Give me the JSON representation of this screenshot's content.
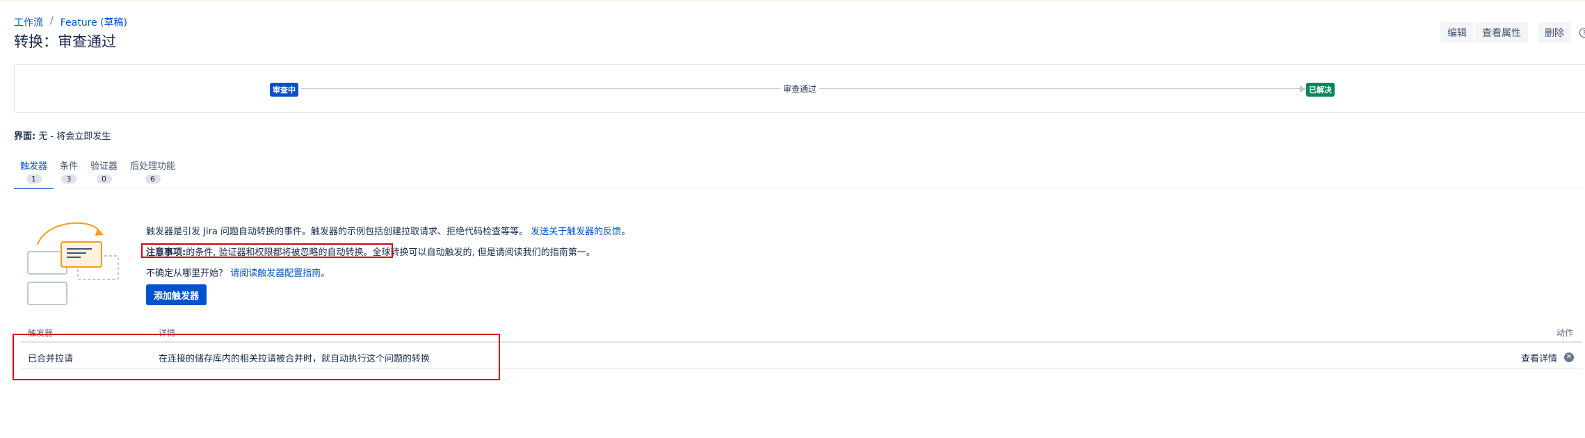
{
  "breadcrumb": {
    "root": "工作流",
    "separator": "/",
    "current": "Feature (草稿)"
  },
  "page_title": "转换：审查通过",
  "header_actions": {
    "edit": "编辑",
    "properties": "查看属性",
    "delete": "删除",
    "help": "?"
  },
  "workflow": {
    "from_status": "审查中",
    "transition": "审查通过",
    "to_status": "已解决",
    "colors": {
      "from": "#0052cc",
      "to": "#00875a"
    }
  },
  "screen": {
    "label": "界面:",
    "value": "无 - 将会立即发生"
  },
  "tabs": [
    {
      "label": "触发器",
      "count": "1",
      "active": true
    },
    {
      "label": "条件",
      "count": "3",
      "active": false
    },
    {
      "label": "验证器",
      "count": "0",
      "active": false
    },
    {
      "label": "后处理功能",
      "count": "6",
      "active": false
    }
  ],
  "info": {
    "line1_text": "触发器是引发 Jira 问题自动转换的事件。触发器的示例包括创建拉取请求、拒绝代码检查等等。",
    "line1_link": "发送关于触发器的反馈",
    "line1_end": "。",
    "line2_bold": "注意事项:",
    "line2_text": "的条件, 验证器和权限都将被忽略的自动转换。全球转换可以自动触发的, 但是请阅读我们的指南第一。",
    "line3_text": "不确定从哪里开始？",
    "line3_link": "请阅读触发器配置指南",
    "line3_end": "。",
    "add_button": "添加触发器"
  },
  "table": {
    "headers": {
      "trigger": "触发器",
      "details": "详情",
      "actions": "动作"
    },
    "rows": [
      {
        "trigger": "已合并拉请",
        "details": "在连接的储存库内的相关拉请被合并时，就自动执行这个问题的转换",
        "action": "查看详情"
      }
    ]
  },
  "annotation_color": "#d0021b"
}
